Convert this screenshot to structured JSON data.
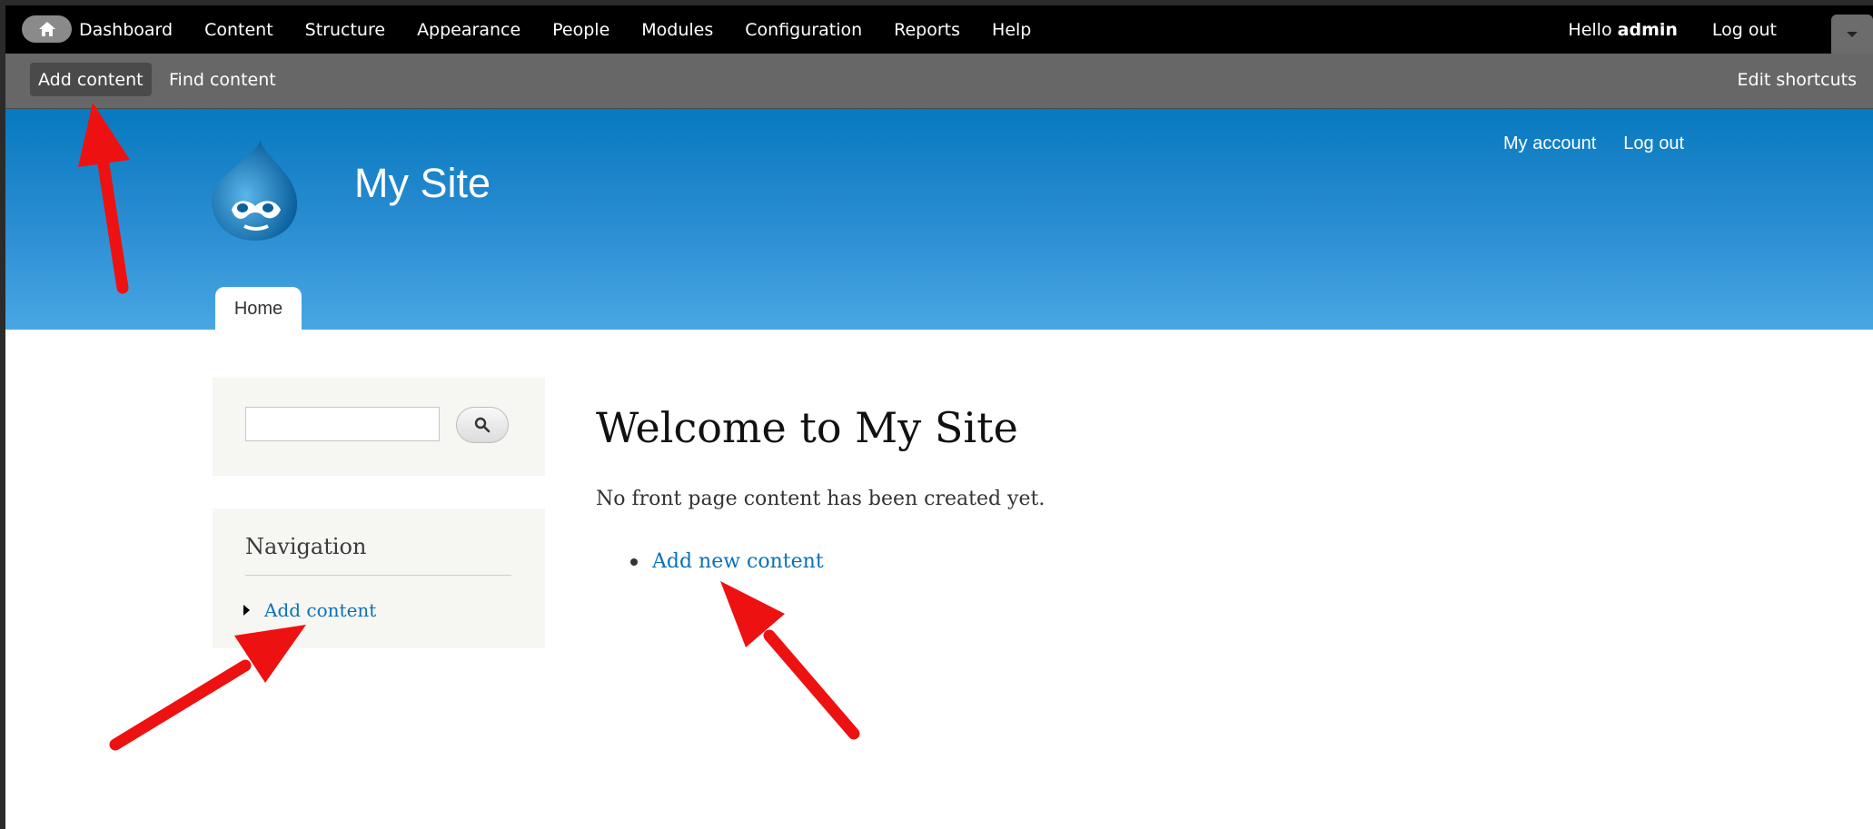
{
  "toolbar": {
    "menu": [
      "Dashboard",
      "Content",
      "Structure",
      "Appearance",
      "People",
      "Modules",
      "Configuration",
      "Reports",
      "Help"
    ],
    "hello_prefix": "Hello",
    "username": "admin",
    "logout": "Log out"
  },
  "shortcuts": {
    "add_content": "Add content",
    "find_content": "Find content",
    "edit_shortcuts": "Edit shortcuts"
  },
  "header": {
    "site_name": "My Site",
    "secondary_links": [
      "My account",
      "Log out"
    ],
    "tabs": [
      "Home"
    ]
  },
  "sidebar": {
    "search": {
      "value": "",
      "placeholder": ""
    },
    "navigation": {
      "title": "Navigation",
      "items": [
        "Add content"
      ]
    }
  },
  "main": {
    "title": "Welcome to My Site",
    "text": "No front page content has been created yet.",
    "links": [
      "Add new content"
    ]
  },
  "colors": {
    "annotation_arrow": "#ee1111",
    "link": "#0b71b8",
    "header_top": "#0779bf",
    "header_bottom": "#48a7e3"
  }
}
